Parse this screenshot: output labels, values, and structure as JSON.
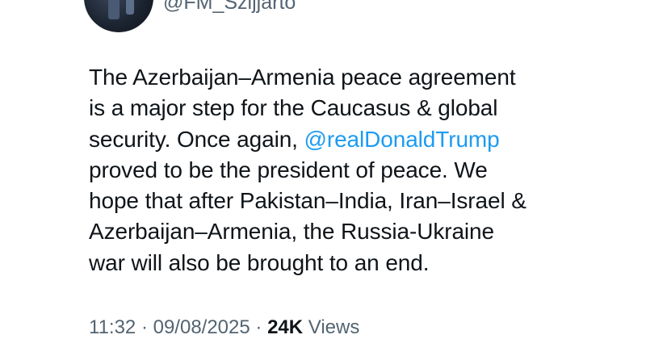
{
  "author": {
    "handle": "@FM_Szijjarto"
  },
  "tweet": {
    "line1": "The Azerbaijan–Armenia peace agreement",
    "line2": "is a major step for the Caucasus & global",
    "line3_prefix": "security. Once again, ",
    "mention": "@realDonaldTrump",
    "line4": "proved to be the president of peace. We",
    "line5": "hope that after Pakistan–India, Iran–Israel &",
    "line6": "Azerbaijan–Armenia, the Russia-Ukraine",
    "line7": "war will also be brought to an end."
  },
  "meta": {
    "time": "11:32",
    "separator1": " · ",
    "date": "09/08/2025",
    "separator2": " · ",
    "views_count": "24K",
    "views_label": " Views"
  },
  "colors": {
    "text": "#0f1419",
    "secondary": "#536471",
    "link": "#1d9bf0"
  }
}
